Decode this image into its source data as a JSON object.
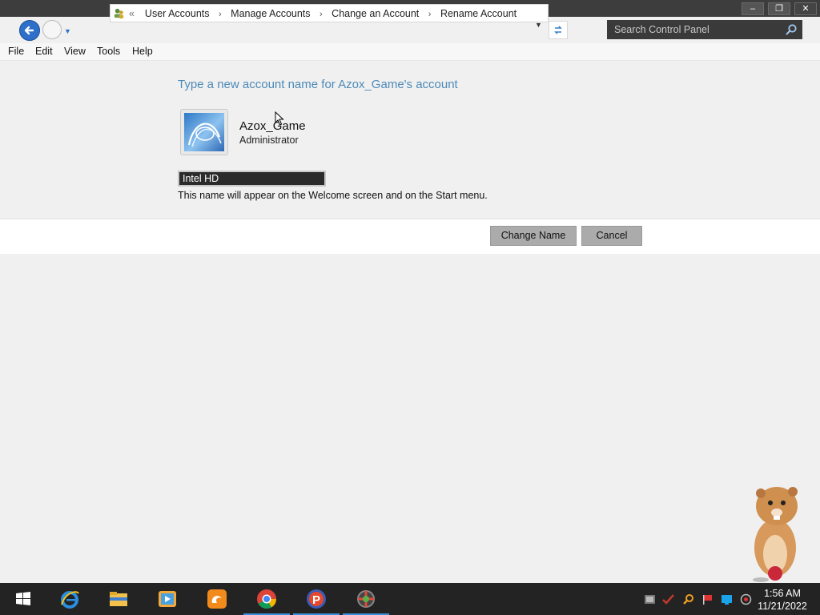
{
  "window": {
    "minimize_label": "–",
    "restore_label": "❐",
    "close_label": "✕"
  },
  "nav": {
    "breadcrumb_prefix": "«",
    "breadcrumbs": [
      "User Accounts",
      "Manage Accounts",
      "Change an Account",
      "Rename Account"
    ],
    "search_placeholder": "Search Control Panel"
  },
  "menu": [
    "File",
    "Edit",
    "View",
    "Tools",
    "Help"
  ],
  "main": {
    "heading": "Type a new account name for Azox_Game's account",
    "account_name": "Azox_Game",
    "account_role": "Administrator",
    "name_input_value": "Intel HD",
    "hint": "This name will appear on the Welcome screen and on the Start menu.",
    "change_button": "Change Name",
    "cancel_button": "Cancel"
  },
  "taskbar": {
    "apps": [
      {
        "name": "start-button",
        "icon": "windows-logo-icon",
        "active": false
      },
      {
        "name": "internet-explorer",
        "icon": "internet-explorer-icon",
        "active": false
      },
      {
        "name": "file-explorer",
        "icon": "folder-icon",
        "active": false
      },
      {
        "name": "media-player",
        "icon": "media-player-icon",
        "active": false
      },
      {
        "name": "uc-browser",
        "icon": "uc-browser-icon",
        "active": false
      },
      {
        "name": "google-chrome",
        "icon": "chrome-icon",
        "active": true
      },
      {
        "name": "app-p",
        "icon": "p-app-icon",
        "active": true
      },
      {
        "name": "control-panel",
        "icon": "control-panel-icon",
        "active": true
      }
    ],
    "clock_time": "1:56 AM",
    "clock_date": "11/21/2022"
  },
  "colors": {
    "heading": "#4d8ab8",
    "taskbar": "#232323",
    "titlebar": "#3d3d3d",
    "button": "#ababab"
  }
}
